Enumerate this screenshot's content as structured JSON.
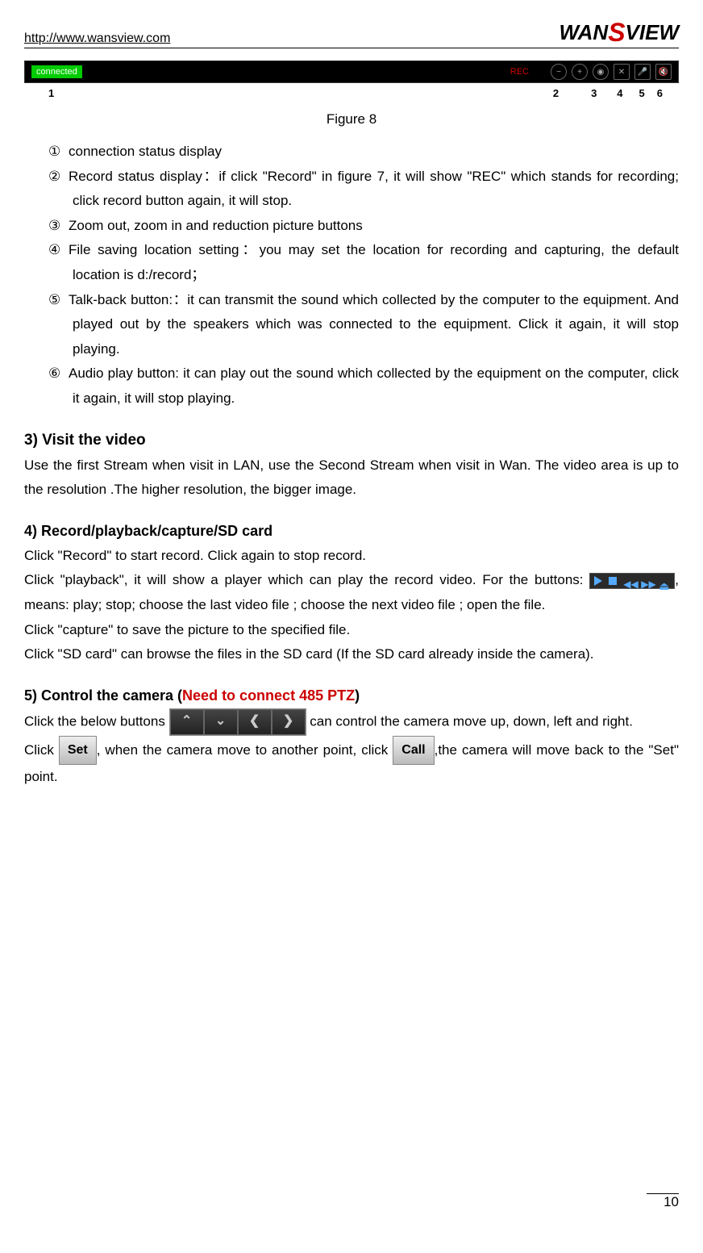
{
  "header": {
    "url": "http://www.wansview.com",
    "brand_part1": "WAN",
    "brand_part2": "S",
    "brand_part3": "VIEW"
  },
  "figure8": {
    "connected_label": "connected",
    "rec_label": "REC",
    "callout_1": "1",
    "callout_2": "2",
    "callout_3": "3",
    "callout_4": "4",
    "callout_5": "5",
    "callout_6": "6",
    "caption": "Figure 8"
  },
  "list": {
    "item1_num": "①",
    "item1": "connection status display",
    "item2_num": "②",
    "item2": "Record status display：if click \"Record\" in figure 7, it will show \"REC\" which stands for recording; click record button again, it will stop.",
    "item3_num": "③",
    "item3": "Zoom out, zoom in and reduction picture buttons",
    "item4_num": "④",
    "item4": "File saving location setting：you may set the location for recording and capturing, the default location is d:/record；",
    "item5_num": "⑤",
    "item5": "Talk-back button:：it can transmit the sound which collected by the computer to the equipment. And played out by the speakers which was connected to the equipment. Click it again, it will stop playing.",
    "item6_num": "⑥",
    "item6": "Audio play button: it can play out the sound which collected by the equipment on the computer, click it again, it will stop playing."
  },
  "section3": {
    "heading": "3) Visit the video",
    "body": "Use the first Stream when visit in LAN, use the Second Stream when visit in Wan. The video area is up to the resolution .The higher resolution, the bigger image."
  },
  "section4": {
    "heading": "4) Record/playback/capture/SD card",
    "p1": "Click \"Record\" to start record. Click again to stop record.",
    "p2a": "Click \"playback\", it will show a player which can play the record video. For the buttons: ",
    "p2b": ", means: play; stop; choose the last video file ; choose the next video file ; open the file.",
    "p3": "Click \"capture\" to save the picture to the specified file.",
    "p4": "Click \"SD card\" can browse the files in the SD card (If the SD card already inside the camera)."
  },
  "section5": {
    "heading_a": "5) Control the camera (",
    "heading_red": "Need to connect 485 PTZ",
    "heading_b": ")",
    "p1a": "Click the below buttons ",
    "p1b": " can control the camera move up, down, left and right.",
    "p2a": "Click ",
    "set_label": "Set",
    "p2b": ", when the camera move to another point, click ",
    "call_label": "Call",
    "p2c": ",the camera will move back to the \"Set\" point."
  },
  "page_number": "10"
}
